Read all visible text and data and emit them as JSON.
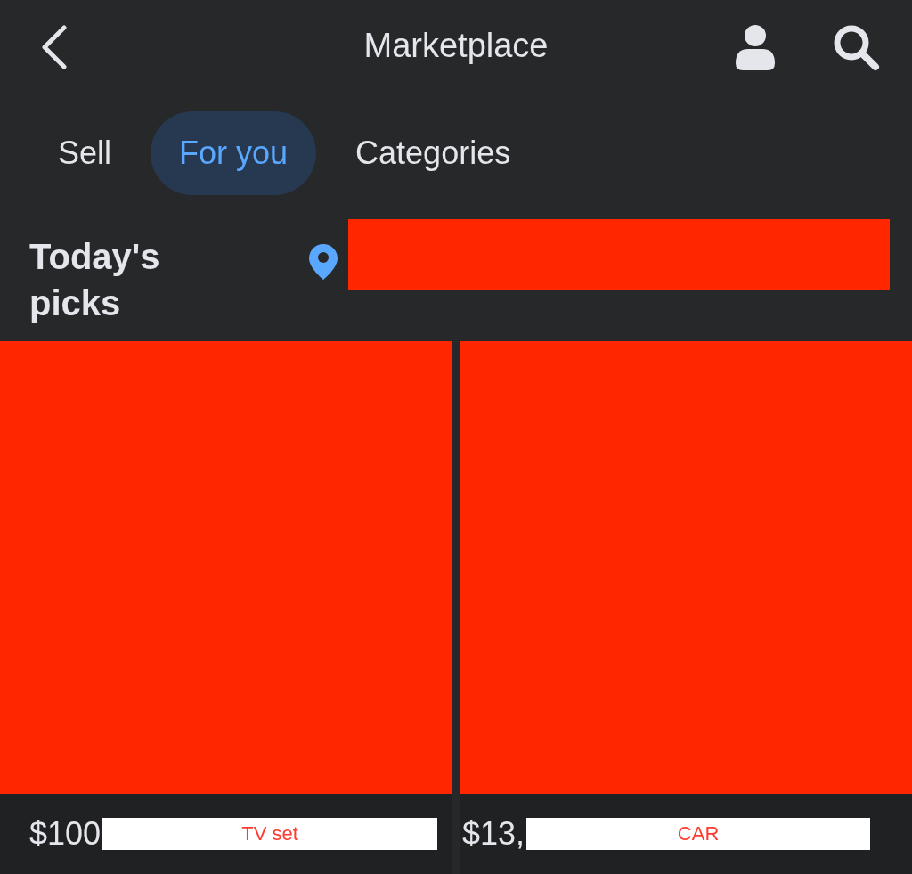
{
  "header": {
    "title": "Marketplace"
  },
  "tabs": [
    {
      "label": "Sell",
      "selected": false
    },
    {
      "label": "For you",
      "selected": true
    },
    {
      "label": "Categories",
      "selected": false
    }
  ],
  "section": {
    "title": "Today's picks",
    "location": {
      "kind": "redaction"
    }
  },
  "listings": [
    {
      "image": {
        "kind": "redaction"
      },
      "price": "$100",
      "title": "TV set"
    },
    {
      "image": {
        "kind": "redaction"
      },
      "price": "$13,",
      "title": "CAR"
    }
  ]
}
